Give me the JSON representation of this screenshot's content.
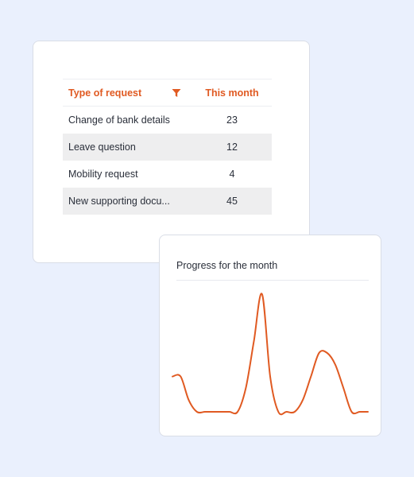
{
  "requests_table": {
    "header": {
      "type_label": "Type of request",
      "month_label": "This month",
      "filter_icon": "filter-icon"
    },
    "rows": [
      {
        "type": "Change of bank details",
        "count": "23"
      },
      {
        "type": "Leave question",
        "count": "12"
      },
      {
        "type": "Mobility request",
        "count": "4"
      },
      {
        "type": "New supporting docu...",
        "count": "45"
      }
    ]
  },
  "progress_card": {
    "title": "Progress for the month",
    "line_color": "#e05a22"
  },
  "chart_data": {
    "type": "line",
    "title": "Progress for the month",
    "xlabel": "",
    "ylabel": "",
    "grid": false,
    "legend": "none",
    "x": [
      0,
      0.5,
      1,
      1.5,
      2,
      2.5,
      3,
      3.5,
      4,
      4.5,
      5,
      5.5,
      6,
      6.5,
      7,
      7.5,
      8,
      8.5,
      9,
      9.5,
      10,
      10.5,
      11,
      11.5,
      12
    ],
    "series": [
      {
        "values": [
          0.3,
          0.3,
          0.1,
          0,
          0,
          0,
          0,
          0,
          0,
          0.2,
          0.6,
          1,
          0.3,
          0,
          0,
          0,
          0.1,
          0.3,
          0.5,
          0.5,
          0.4,
          0.2,
          0,
          0,
          0
        ]
      }
    ],
    "ylim": [
      0,
      1
    ]
  },
  "colors": {
    "accent": "#e05a22",
    "page_background": "#eaf0fd",
    "stripe": "#eeeeef"
  }
}
